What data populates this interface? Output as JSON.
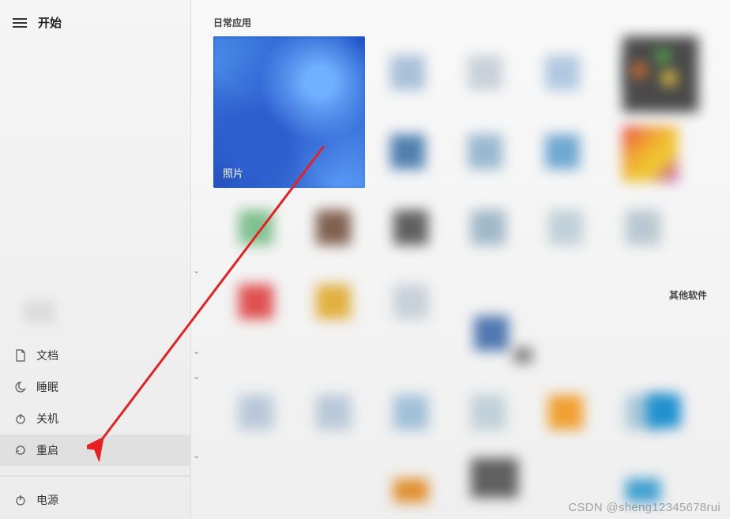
{
  "sidebar": {
    "title": "开始",
    "items": {
      "documents": "文档",
      "sleep": "睡眠",
      "shutdown": "关机",
      "restart": "重启"
    },
    "power": "电源"
  },
  "main": {
    "section_daily": "日常应用",
    "section_other": "其他软件",
    "photos_label": "照片"
  },
  "watermark": "CSDN @sheng12345678rui"
}
